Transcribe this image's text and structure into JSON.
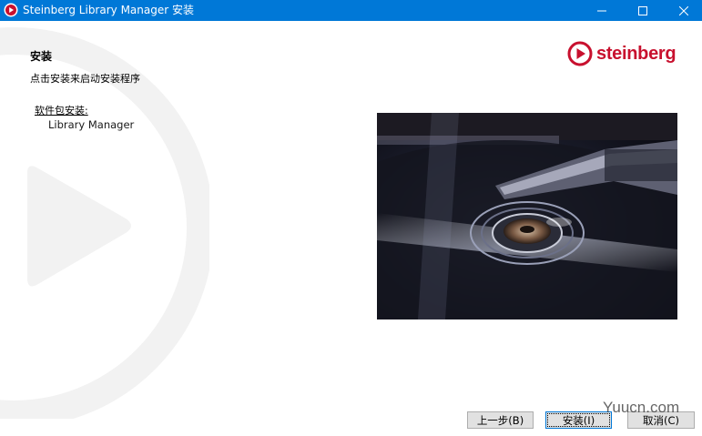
{
  "window": {
    "title": "Steinberg Library Manager 安装",
    "accent_color": "#0078d7"
  },
  "controls": {
    "minimize_icon": "minimize-icon",
    "maximize_icon": "maximize-icon",
    "close_icon": "close-icon"
  },
  "content": {
    "heading": "安装",
    "subtext": "点击安装来启动安装程序",
    "package_label": "软件包安装:",
    "packages": [
      "Library Manager"
    ]
  },
  "logo": {
    "text": "steinberg",
    "color": "#c8102e"
  },
  "buttons": {
    "back": "上一步(B)",
    "install": "安装(I)",
    "cancel": "取消(C)"
  },
  "site_watermark": "Yuucn.com"
}
